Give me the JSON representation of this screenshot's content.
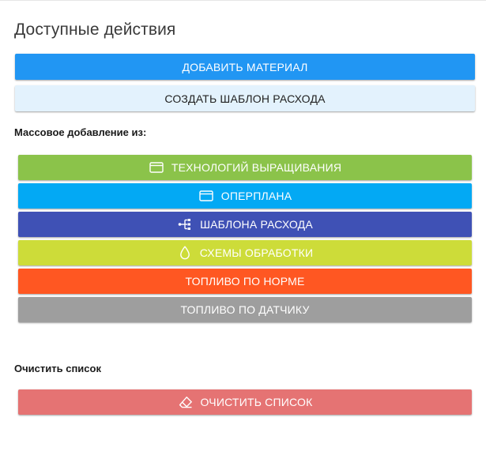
{
  "panel": {
    "title": "Доступные действия"
  },
  "actions": {
    "add_material": {
      "label": "ДОБАВИТЬ МАТЕРИАЛ",
      "color": "#2196F3"
    },
    "create_template": {
      "label": "СОЗДАТЬ ШАБЛОН РАСХОДА",
      "color": "#E3F2FD"
    }
  },
  "bulk_add": {
    "heading": "Массовое добавление из:",
    "buttons": [
      {
        "label": "ТЕХНОЛОГИЙ ВЫРАЩИВАНИЯ",
        "icon": "card-icon",
        "color": "#8BC34A"
      },
      {
        "label": "ОПЕРПЛАНА",
        "icon": "card-icon",
        "color": "#03A9F4"
      },
      {
        "label": "ШАБЛОНА РАСХОДА",
        "icon": "hierarchy-icon",
        "color": "#3F51B5"
      },
      {
        "label": "СХЕМЫ ОБРАБОТКИ",
        "icon": "drop-icon",
        "color": "#CDDC39"
      },
      {
        "label": "ТОПЛИВО ПО НОРМЕ",
        "icon": "",
        "color": "#FF5722"
      },
      {
        "label": "ТОПЛИВО ПО ДАТЧИКУ",
        "icon": "",
        "color": "#9E9E9E"
      }
    ]
  },
  "clear": {
    "heading": "Очистить список",
    "button": {
      "label": "ОЧИСТИТЬ СПИСОК",
      "icon": "eraser-icon",
      "color": "#E57373"
    }
  }
}
